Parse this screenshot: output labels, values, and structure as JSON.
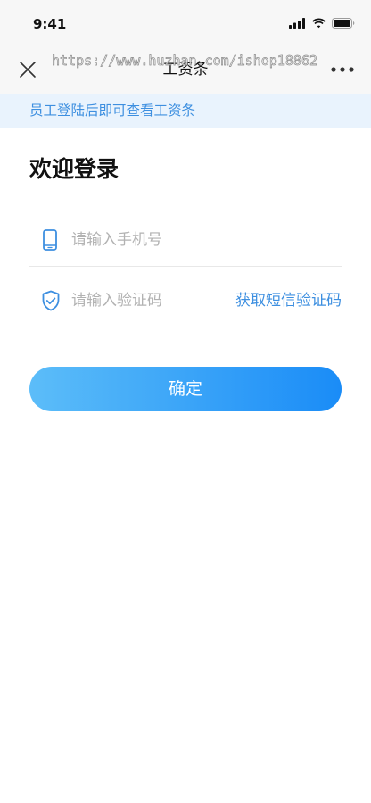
{
  "status_bar": {
    "time": "9:41",
    "icons": [
      "signal-icon",
      "wifi-icon",
      "battery-icon"
    ]
  },
  "nav": {
    "title": "工资条",
    "left_icon": "close-icon",
    "right_icon": "more-icon"
  },
  "watermark_text": "https://www.huzhan.com/ishop18862",
  "banner": {
    "text": "员工登陆后即可查看工资条"
  },
  "login": {
    "heading": "欢迎登录",
    "phone": {
      "icon": "phone-icon",
      "placeholder": "请输入手机号",
      "value": ""
    },
    "code": {
      "icon": "shield-check-icon",
      "placeholder": "请输入验证码",
      "value": ""
    },
    "get_code_label": "获取短信验证码",
    "submit_label": "确定"
  },
  "colors": {
    "accent": "#3d8fe0",
    "top_bg": "#f7f7f7",
    "banner_bg": "#e9f3fd",
    "button_start": "#5cbdf9",
    "button_end": "#1a8cf7"
  }
}
